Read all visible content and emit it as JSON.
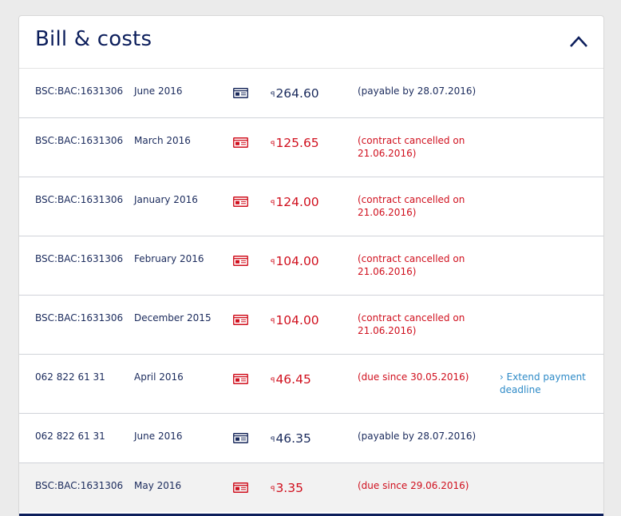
{
  "title": "Bill & costs",
  "currency_symbol": "ꟼ",
  "action_prefix": "›",
  "colors": {
    "due": "#d0101e",
    "normal": "#1a2a5c",
    "link": "#2d8ac7",
    "accent": "#0d1f5c"
  },
  "bills": [
    {
      "ref": "BSC:BAC:1631306",
      "period": "June 2016",
      "icon": "invoice-icon",
      "status": "normal",
      "amount": "264.60",
      "note": "(payable by 28.07.2016)",
      "action": ""
    },
    {
      "ref": "BSC:BAC:1631306",
      "period": "March 2016",
      "icon": "invoice-icon",
      "status": "due",
      "amount": "125.65",
      "note": "(contract cancelled on 21.06.2016)",
      "action": ""
    },
    {
      "ref": "BSC:BAC:1631306",
      "period": "January 2016",
      "icon": "invoice-icon",
      "status": "due",
      "amount": "124.00",
      "note": "(contract cancelled on 21.06.2016)",
      "action": ""
    },
    {
      "ref": "BSC:BAC:1631306",
      "period": "February 2016",
      "icon": "invoice-icon",
      "status": "due",
      "amount": "104.00",
      "note": "(contract cancelled on 21.06.2016)",
      "action": ""
    },
    {
      "ref": "BSC:BAC:1631306",
      "period": "December 2015",
      "icon": "invoice-icon",
      "status": "due",
      "amount": "104.00",
      "note": "(contract cancelled on 21.06.2016)",
      "action": ""
    },
    {
      "ref": "062 822 61 31",
      "period": "April 2016",
      "icon": "invoice-icon",
      "status": "due",
      "amount": "46.45",
      "note": "(due since 30.05.2016)",
      "action": "Extend payment deadline"
    },
    {
      "ref": "062 822 61 31",
      "period": "June 2016",
      "icon": "invoice-icon",
      "status": "normal",
      "amount": "46.35",
      "note": "(payable by 28.07.2016)",
      "action": ""
    },
    {
      "ref": "BSC:BAC:1631306",
      "period": "May 2016",
      "icon": "invoice-icon",
      "status": "due",
      "amount": "3.35",
      "note": "(due since 29.06.2016)",
      "action": ""
    }
  ]
}
